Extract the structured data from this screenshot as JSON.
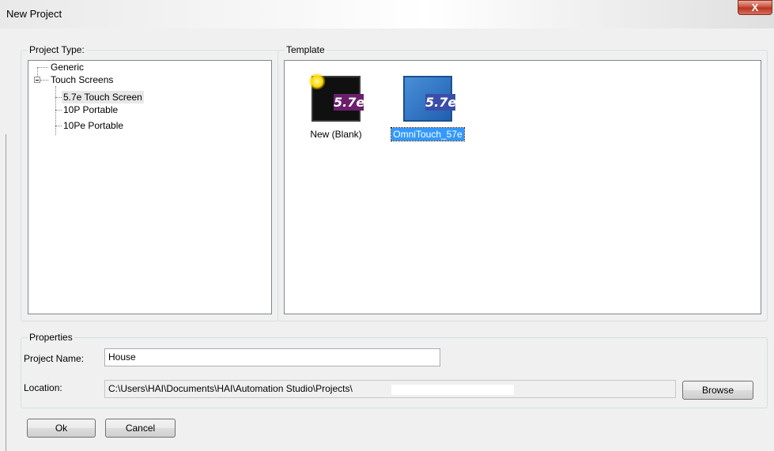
{
  "window": {
    "title": "New Project",
    "close_glyph": "X"
  },
  "project_type": {
    "label": "Project Type:",
    "tree": [
      {
        "label": "Generic"
      },
      {
        "label": "Touch Screens",
        "expander": "minus"
      },
      {
        "label": "5.7e Touch Screen",
        "selected": true
      },
      {
        "label": "10P Portable"
      },
      {
        "label": "10Pe Portable"
      }
    ]
  },
  "template": {
    "label": "Template",
    "items": [
      {
        "label": "New (Blank)",
        "badge": "5.7e",
        "icon": "new-blank-icon",
        "selected": false
      },
      {
        "label": "OmniTouch_57e",
        "badge": "5.7e",
        "icon": "omnitouch-icon",
        "selected": true
      }
    ]
  },
  "properties": {
    "label": "Properties",
    "project_name_label": "Project Name:",
    "project_name_value": "House",
    "location_label": "Location:",
    "location_value": "C:\\Users\\HAI\\Documents\\HAI\\Automation Studio\\Projects\\",
    "browse_label": "Browse"
  },
  "buttons": {
    "ok_label": "Ok",
    "cancel_label": "Cancel"
  },
  "colors": {
    "selection": "#3399ff",
    "badge_purple": "#6b1f6b",
    "badge_blue": "#3a4ea8",
    "close": "#c74833"
  }
}
